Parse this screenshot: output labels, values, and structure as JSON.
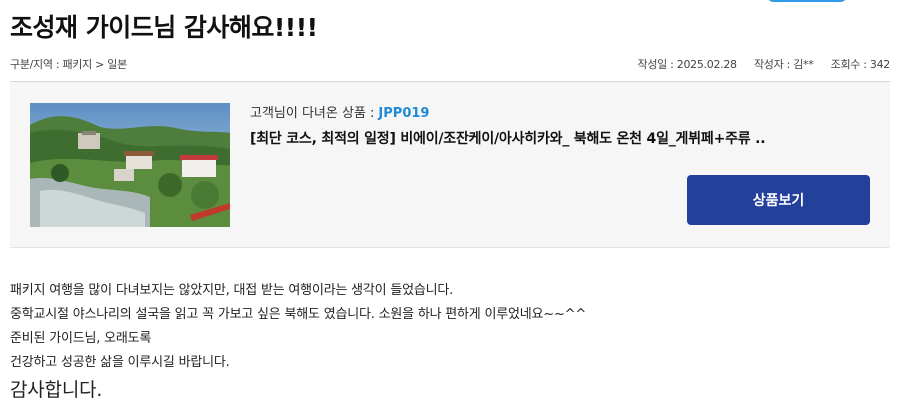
{
  "post": {
    "title": "조성재 가이드님 감사해요!!!!",
    "breadcrumb": "구분/지역 : 패키지 > 일본",
    "date_text": "작성일 : 2025.02.28",
    "author_text": "작성자 : 김**",
    "views_text": "조회수 : 342"
  },
  "product": {
    "visited_label": "고객님이 다녀온 상품 :",
    "code": "JPP019",
    "name": "[최단 코스, 최적의 일정] 비에이/조잔케이/아사히카와_ 북해도 온천 4일_게뷔페+주류 ..",
    "button_label": "상품보기",
    "button_color": "#23409a",
    "code_color": "#1f8ad8"
  },
  "content": {
    "lines": [
      "패키지 여행을 많이 다녀보지는 않았지만, 대접 받는 여행이라는 생각이 들었습니다.",
      "중학교시절 야스나리의 설국을 읽고 꼭 가보고 싶은 북해도 였습니다. 소원을 하나 편하게 이루었네요~~^^",
      "준비된 가이드님, 오래도록",
      "건강하고 성공한 삶을 이루시길 바랍니다.",
      "감사합니다."
    ]
  }
}
